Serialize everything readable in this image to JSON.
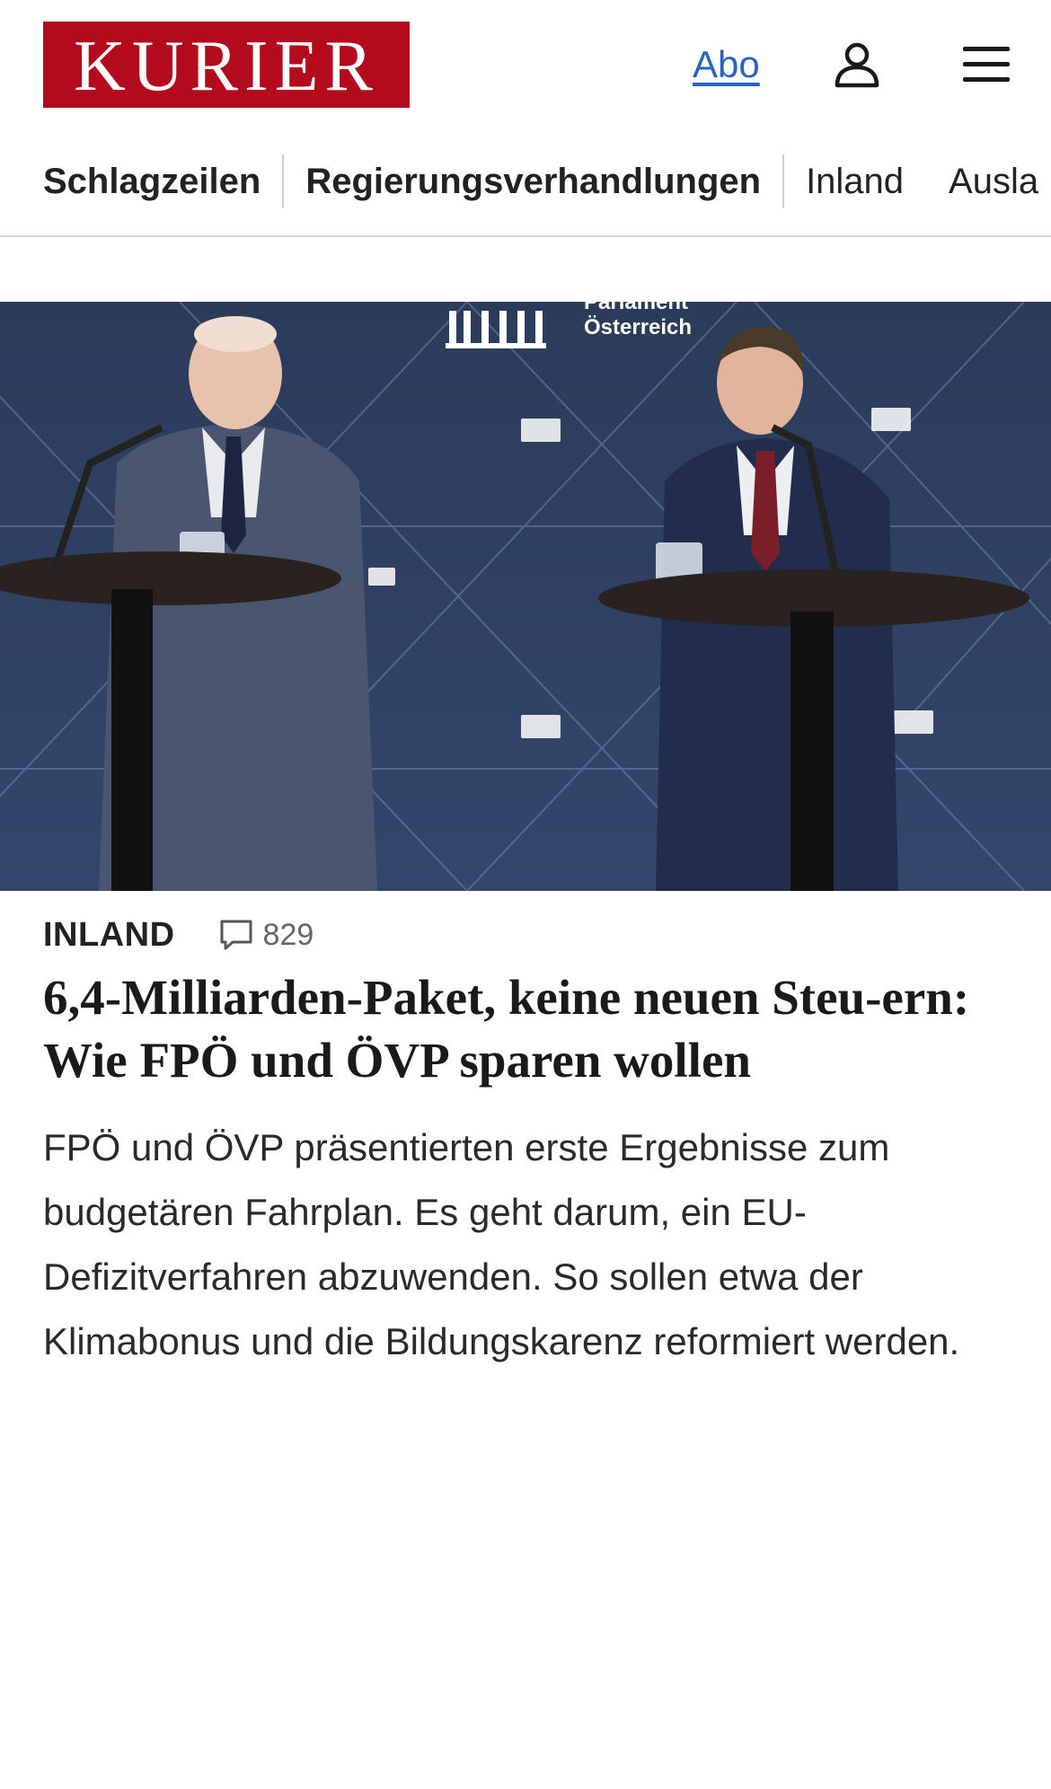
{
  "header": {
    "logo_text": "KURIER",
    "abo_label": "Abo",
    "user_icon": "user-icon",
    "menu_icon": "hamburger-menu-icon",
    "brand_color": "#b30a1e",
    "link_color": "#2563c9"
  },
  "nav": {
    "items": [
      {
        "label": "Schlagzeilen"
      },
      {
        "label": "Regierungsverhandlungen"
      },
      {
        "label": "Inland"
      },
      {
        "label": "Ausla"
      }
    ]
  },
  "article": {
    "image_alt": "Zwei Politiker an Rednerpulten vor einer Wand des Parlaments Österreich",
    "backdrop_text_line1": "Parlament",
    "backdrop_text_line2": "Österreich",
    "kicker": "INLAND",
    "comment_icon": "comment-icon",
    "comment_count": "829",
    "headline": "6,4-Milliarden-Paket, keine neuen Steu-ern: Wie FPÖ und ÖVP sparen wollen",
    "teaser": "FPÖ und ÖVP präsentierten erste Ergebnisse zum budgetären Fahrplan. Es geht darum, ein EU-Defizitverfahren abzuwenden. So sollen etwa der Klimabonus und die Bildungskarenz reformiert werden."
  }
}
